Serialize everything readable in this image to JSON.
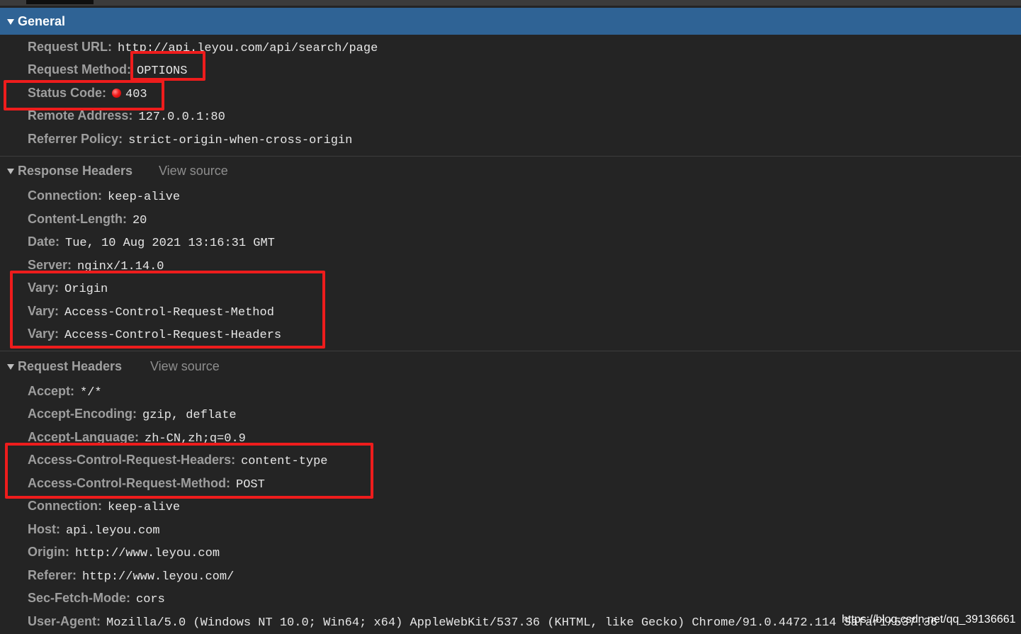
{
  "general": {
    "title": "General",
    "rows": [
      {
        "key": "Request URL:",
        "value": "http://api.leyou.com/api/search/page"
      },
      {
        "key": "Request Method:",
        "value": "OPTIONS"
      },
      {
        "key": "Status Code:",
        "value": "403",
        "status_color": "#f21c1c"
      },
      {
        "key": "Remote Address:",
        "value": "127.0.0.1:80"
      },
      {
        "key": "Referrer Policy:",
        "value": "strict-origin-when-cross-origin"
      }
    ]
  },
  "response_headers": {
    "title": "Response Headers",
    "view_source": "View source",
    "rows": [
      {
        "key": "Connection:",
        "value": "keep-alive"
      },
      {
        "key": "Content-Length:",
        "value": "20"
      },
      {
        "key": "Date:",
        "value": "Tue, 10 Aug 2021 13:16:31 GMT"
      },
      {
        "key": "Server:",
        "value": "nginx/1.14.0"
      },
      {
        "key": "Vary:",
        "value": "Origin"
      },
      {
        "key": "Vary:",
        "value": "Access-Control-Request-Method"
      },
      {
        "key": "Vary:",
        "value": "Access-Control-Request-Headers"
      }
    ]
  },
  "request_headers": {
    "title": "Request Headers",
    "view_source": "View source",
    "rows": [
      {
        "key": "Accept:",
        "value": "*/*"
      },
      {
        "key": "Accept-Encoding:",
        "value": "gzip, deflate"
      },
      {
        "key": "Accept-Language:",
        "value": "zh-CN,zh;q=0.9"
      },
      {
        "key": "Access-Control-Request-Headers:",
        "value": "content-type"
      },
      {
        "key": "Access-Control-Request-Method:",
        "value": "POST"
      },
      {
        "key": "Connection:",
        "value": "keep-alive"
      },
      {
        "key": "Host:",
        "value": "api.leyou.com"
      },
      {
        "key": "Origin:",
        "value": "http://www.leyou.com"
      },
      {
        "key": "Referer:",
        "value": "http://www.leyou.com/"
      },
      {
        "key": "Sec-Fetch-Mode:",
        "value": "cors"
      },
      {
        "key": "User-Agent:",
        "value": "Mozilla/5.0 (Windows NT 10.0; Win64; x64) AppleWebKit/537.36 (KHTML, like Gecko) Chrome/91.0.4472.114 Safari/537.36"
      }
    ]
  },
  "watermark": "https://blog.csdn.net/qq_39136661",
  "colors": {
    "highlight_box": "#ee1c1c",
    "general_header_bg": "#2f6395",
    "panel_bg": "#242424"
  }
}
